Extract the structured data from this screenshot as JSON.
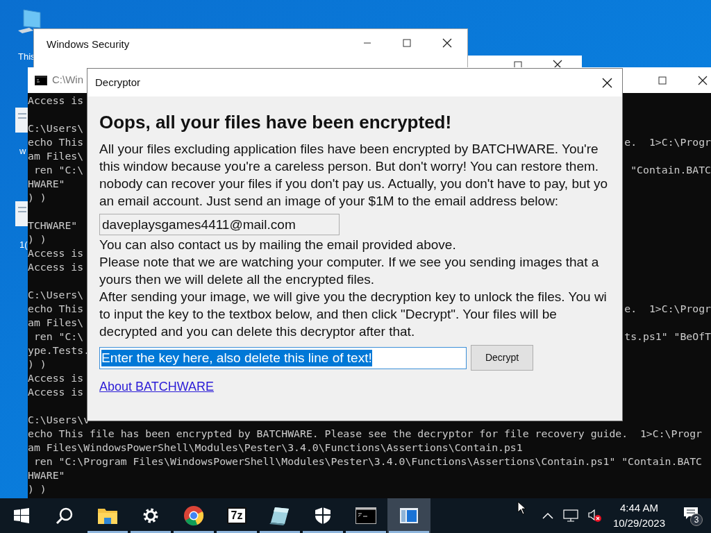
{
  "desktop_icons": [
    {
      "kind": "pc",
      "label": "This"
    },
    {
      "kind": "doc",
      "label": "w"
    },
    {
      "kind": "doc",
      "label": "1("
    }
  ],
  "security_window": {
    "title": "Windows Security"
  },
  "console_window": {
    "title": "C:\\Win",
    "lines": [
      {
        "kind": "split",
        "left": "Access is"
      },
      {
        "kind": "blank"
      },
      {
        "kind": "split",
        "left": "C:\\Users\\"
      },
      {
        "kind": "split",
        "left": "echo This",
        "right": "e.  1>C:\\Progr"
      },
      {
        "kind": "split",
        "left": "am Files\\"
      },
      {
        "kind": "split",
        "left": " ren \"C:\\",
        "right": "\"Contain.BATC"
      },
      {
        "kind": "split",
        "left": "HWARE\""
      },
      {
        "kind": "split",
        "left": ") )"
      },
      {
        "kind": "blank"
      },
      {
        "kind": "split",
        "left": "TCHWARE\""
      },
      {
        "kind": "split",
        "left": ") )"
      },
      {
        "kind": "split",
        "left": "Access is"
      },
      {
        "kind": "split",
        "left": "Access is"
      },
      {
        "kind": "blank"
      },
      {
        "kind": "split",
        "left": "C:\\Users\\"
      },
      {
        "kind": "split",
        "left": "echo This",
        "right": "e.  1>C:\\Progr"
      },
      {
        "kind": "split",
        "left": "am Files\\"
      },
      {
        "kind": "split",
        "left": " ren \"C:\\",
        "right": "ts.ps1\" \"BeOfT"
      },
      {
        "kind": "split",
        "left": "ype.Tests."
      },
      {
        "kind": "split",
        "left": ") )"
      },
      {
        "kind": "split",
        "left": "Access is"
      },
      {
        "kind": "split",
        "left": "Access is"
      },
      {
        "kind": "blank"
      },
      {
        "kind": "split",
        "left": "C:\\Users\\v"
      },
      {
        "kind": "full",
        "text": "echo This file has been encrypted by BATCHWARE. Please see the decryptor for file recovery guide.  1>C:\\Progr"
      },
      {
        "kind": "full",
        "text": "am Files\\WindowsPowerShell\\Modules\\Pester\\3.4.0\\Functions\\Assertions\\Contain.ps1"
      },
      {
        "kind": "full",
        "text": " ren \"C:\\Program Files\\WindowsPowerShell\\Modules\\Pester\\3.4.0\\Functions\\Assertions\\Contain.ps1\" \"Contain.BATC"
      },
      {
        "kind": "full",
        "text": "HWARE\""
      },
      {
        "kind": "full",
        "text": ") )"
      }
    ]
  },
  "dialog": {
    "title": "Decryptor",
    "heading": "Oops, all your files have been encrypted!",
    "paragraph_1": [
      "All your files excluding application files have been encrypted by BATCHWARE. You're",
      "this window because you're a careless person. But don't worry! You can restore them.",
      "nobody can recover your files if you don't pay us. Actually, you don't have to pay, but yo",
      "an email account. Just send an image of your $1M to the email address below:"
    ],
    "email_field": {
      "value": "daveplaysgames4411@mail.com"
    },
    "paragraph_2": [
      "You can also contact us by mailing the email provided above.",
      "Please note that we are watching your computer. If we see you sending images that a",
      "yours then we will delete all the encrypted files.",
      "After sending your image, we will give you the decryption key to unlock the files. You wi",
      "to input the key to the textbox below, and then click \"Decrypt\". Your files will be",
      "decrypted and you can delete this decryptor after that."
    ],
    "key_field": {
      "value": "Enter the key here, also delete this line of text!",
      "text_selected": true
    },
    "decrypt_button": "Decrypt",
    "about_link": "About BATCHWARE"
  },
  "taskbar": {
    "items": [
      {
        "kind": "start",
        "running": false,
        "selected": false
      },
      {
        "kind": "search",
        "running": false,
        "selected": false
      },
      {
        "kind": "folder",
        "running": true,
        "selected": false
      },
      {
        "kind": "gear",
        "running": true,
        "selected": false
      },
      {
        "kind": "browser",
        "running": true,
        "selected": false
      },
      {
        "kind": "archiver",
        "label": "7z",
        "running": true,
        "selected": false
      },
      {
        "kind": "notepad",
        "running": true,
        "selected": false
      },
      {
        "kind": "shield",
        "running": true,
        "selected": false
      },
      {
        "kind": "terminal",
        "running": true,
        "selected": false
      },
      {
        "kind": "window",
        "running": true,
        "selected": true
      }
    ],
    "time": "4:44 AM",
    "date": "10/29/2023",
    "notifications": "3"
  }
}
